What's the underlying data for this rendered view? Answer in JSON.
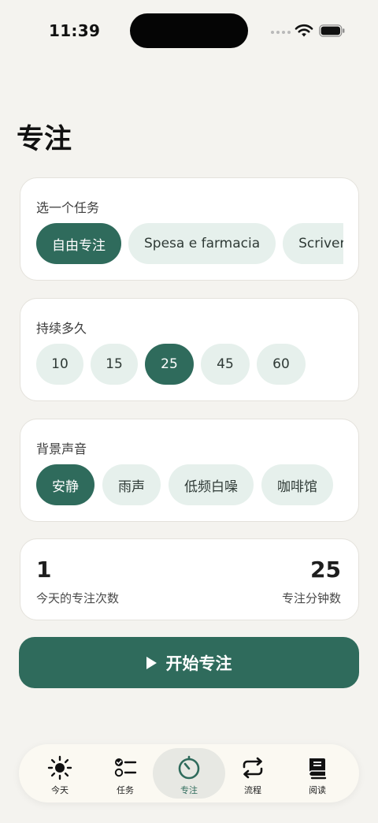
{
  "status_bar": {
    "time": "11:39"
  },
  "page": {
    "title": "专注"
  },
  "task_section": {
    "label": "选一个任务",
    "chips": [
      {
        "label": "自由专注",
        "active": true
      },
      {
        "label": "Spesa e farmacia",
        "active": false
      },
      {
        "label": "Scriver",
        "active": false
      }
    ]
  },
  "duration_section": {
    "label": "持续多久",
    "options": [
      "10",
      "15",
      "25",
      "45",
      "60"
    ],
    "selected": "25"
  },
  "sound_section": {
    "label": "背景声音",
    "options": [
      "安静",
      "雨声",
      "低频白噪",
      "咖啡馆"
    ],
    "selected": "安静"
  },
  "stats": {
    "sessions_today": {
      "value": "1",
      "label": "今天的专注次数"
    },
    "minutes": {
      "value": "25",
      "label": "专注分钟数"
    }
  },
  "start_button": {
    "label": "开始专注",
    "icon": "play-icon"
  },
  "tab_bar": {
    "items": [
      {
        "label": "今天",
        "icon": "sun-icon",
        "active": false
      },
      {
        "label": "任务",
        "icon": "checklist-icon",
        "active": false
      },
      {
        "label": "专注",
        "icon": "timer-icon",
        "active": true
      },
      {
        "label": "流程",
        "icon": "repeat-icon",
        "active": false
      },
      {
        "label": "阅读",
        "icon": "book-icon",
        "active": false
      }
    ]
  },
  "colors": {
    "accent": "#2f6b5c",
    "chip": "#e6f0ec",
    "background": "#f4f3ef"
  }
}
